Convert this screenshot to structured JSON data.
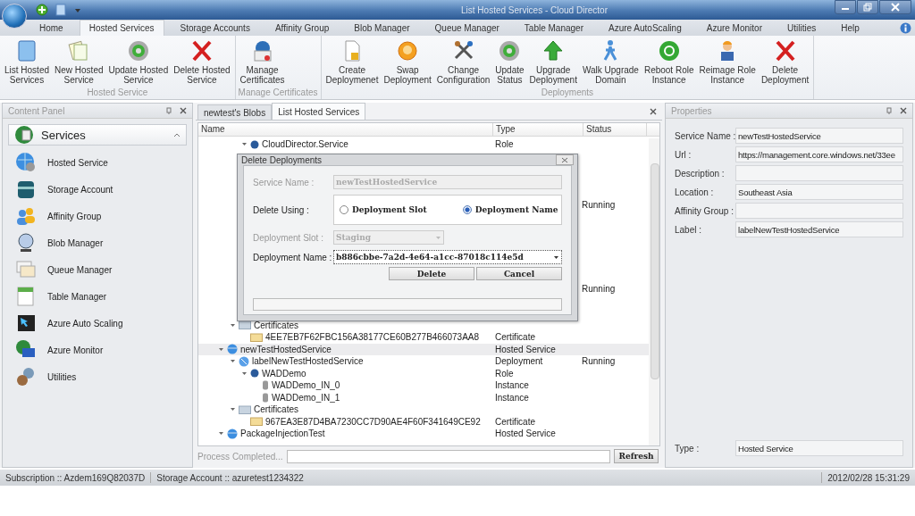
{
  "window": {
    "title": "List Hosted Services - Cloud Director"
  },
  "menu_tabs": [
    {
      "label": "Home",
      "selected": false
    },
    {
      "label": "Hosted Services",
      "selected": true
    },
    {
      "label": "Storage Accounts",
      "selected": false
    },
    {
      "label": "Affinity Group",
      "selected": false
    },
    {
      "label": "Blob Manager",
      "selected": false
    },
    {
      "label": "Queue Manager",
      "selected": false
    },
    {
      "label": "Table Manager",
      "selected": false
    },
    {
      "label": "Azure AutoScaling",
      "selected": false
    },
    {
      "label": "Azure Monitor",
      "selected": false
    },
    {
      "label": "Utilities",
      "selected": false
    },
    {
      "label": "Help",
      "selected": false
    }
  ],
  "ribbon": {
    "groups": [
      {
        "label": "Hosted Service",
        "buttons": [
          "List Hosted\nServices",
          "New Hosted\nService",
          "Update Hosted\nService",
          "Delete Hosted\nService"
        ]
      },
      {
        "label": "Manage Certificates",
        "buttons": [
          "Manage\nCertificates"
        ]
      },
      {
        "label": "Deployments",
        "buttons": [
          "Create\nDeploymenet",
          "Swap\nDeployment",
          "Change\nConfiguration",
          "Update\nStatus",
          "Upgrade\nDeployment",
          "Walk Upgrade\nDomain",
          "Reboot Role\nInstance",
          "Reimage Role\nInstance",
          "Delete\nDeployment"
        ]
      }
    ]
  },
  "content_panel": {
    "title": "Content Panel",
    "section": "Services",
    "items": [
      "Hosted Service",
      "Storage Account",
      "Affinity Group",
      "Blob Manager",
      "Queue Manager",
      "Table Manager",
      "Azure Auto Scaling",
      "Azure Monitor",
      "Utilities"
    ]
  },
  "document_tabs": [
    {
      "label": "newtest's Blobs",
      "selected": false
    },
    {
      "label": "List Hosted Services",
      "selected": true
    }
  ],
  "table": {
    "columns": [
      "Name",
      "Type",
      "Status"
    ],
    "tree": [
      {
        "children": [
          {
            "children": [
              {
                "name": "CloudDirector.Service",
                "type": "Role",
                "kind": "role",
                "expanded": true,
                "selected": false
              }
            ]
          }
        ]
      },
      {
        "covered": true,
        "selected": false
      },
      {
        "covered": true,
        "selected": false
      },
      {
        "covered": true,
        "selected": false
      },
      {
        "covered": true,
        "selected": false
      },
      {
        "covered": true,
        "selected": false,
        "status": "Running"
      },
      {
        "covered": true,
        "selected": false
      },
      {
        "covered": true,
        "selected": false
      },
      {
        "covered": true,
        "selected": false
      },
      {
        "covered": true,
        "selected": false
      },
      {
        "covered": true,
        "selected": false
      },
      {
        "covered": true,
        "selected": false
      },
      {
        "covered": true,
        "selected": false,
        "status": "Running"
      },
      {
        "covered": true,
        "selected": false
      },
      {
        "covered": true,
        "selected": false
      },
      {
        "children": [
          {
            "name": "Certificates",
            "kind": "folder",
            "expanded": true,
            "selected": false,
            "children": [
              {
                "name": "4EE7EB7F62FBC156A38177CE60B277B466073AA8",
                "type": "Certificate",
                "kind": "certificate",
                "selected": false
              }
            ]
          }
        ]
      },
      {
        "name": "newTestHostedService",
        "type": "Hosted Service",
        "kind": "hosted_service",
        "expanded": true,
        "selected": true,
        "children": [
          {
            "name": "labelNewTestHostedService",
            "type": "Deployment",
            "status": "Running",
            "kind": "deployment",
            "expanded": true,
            "selected": false,
            "children": [
              {
                "name": "WADDemo",
                "type": "Role",
                "kind": "role",
                "expanded": true,
                "selected": false,
                "children": [
                  {
                    "name": "WADDemo_IN_0",
                    "type": "Instance",
                    "kind": "instance",
                    "selected": false
                  },
                  {
                    "name": "WADDemo_IN_1",
                    "type": "Instance",
                    "kind": "instance",
                    "selected": false
                  }
                ]
              }
            ]
          },
          {
            "name": "Certificates",
            "kind": "folder",
            "expanded": true,
            "selected": false,
            "children": [
              {
                "name": "967EA3E87D4BA7230CC7D90AE4F60F341649CE92",
                "type": "Certificate",
                "kind": "certificate",
                "selected": false
              }
            ]
          }
        ]
      },
      {
        "name": "PackageInjectionTest",
        "type": "Hosted Service",
        "kind": "hosted_service",
        "expanded": true,
        "selected": false
      }
    ]
  },
  "footer": {
    "status": "Process Completed...",
    "progress": {
      "level": 0
    },
    "button": "Refresh"
  },
  "dialog": {
    "title": "Delete Deployments",
    "service_name": {
      "label": "Service Name :",
      "value": "newTestHostedService",
      "disabled": true
    },
    "delete_using": {
      "label": "Delete Using :",
      "options": [
        {
          "label": "Deployment Slot",
          "selected": false
        },
        {
          "label": "Deployment Name",
          "selected": true
        }
      ]
    },
    "deployment_slot": {
      "label": "Deployment Slot :",
      "value": "Staging",
      "disabled": true
    },
    "deployment_name": {
      "label": "Deployment Name :",
      "value": "b886cbbe-7a2d-4e64-a1cc-87018c114e5d",
      "disabled": false
    },
    "buttons": [
      "Delete",
      "Cancel"
    ],
    "progress": {
      "level": 0
    }
  },
  "properties": {
    "title": "Properties",
    "fields": [
      {
        "label": "Service Name :",
        "value": "newTestHostedService"
      },
      {
        "label": "Url :",
        "value": "https://management.core.windows.net/33ee"
      },
      {
        "label": "Description :"
      },
      {
        "label": "Location :",
        "value": "Southeast Asia"
      },
      {
        "label": "Affinity Group :"
      },
      {
        "label": "Label :",
        "value": "labelNewTestHostedService"
      }
    ],
    "type_field": {
      "label": "Type :",
      "value": "Hosted Service"
    }
  },
  "status_bar": {
    "subscription": "Subscription :: Azdem169Q82037D",
    "storage_account": "Storage Account :: azuretest1234322",
    "datetime": "2012/02/28 15:31:29"
  }
}
